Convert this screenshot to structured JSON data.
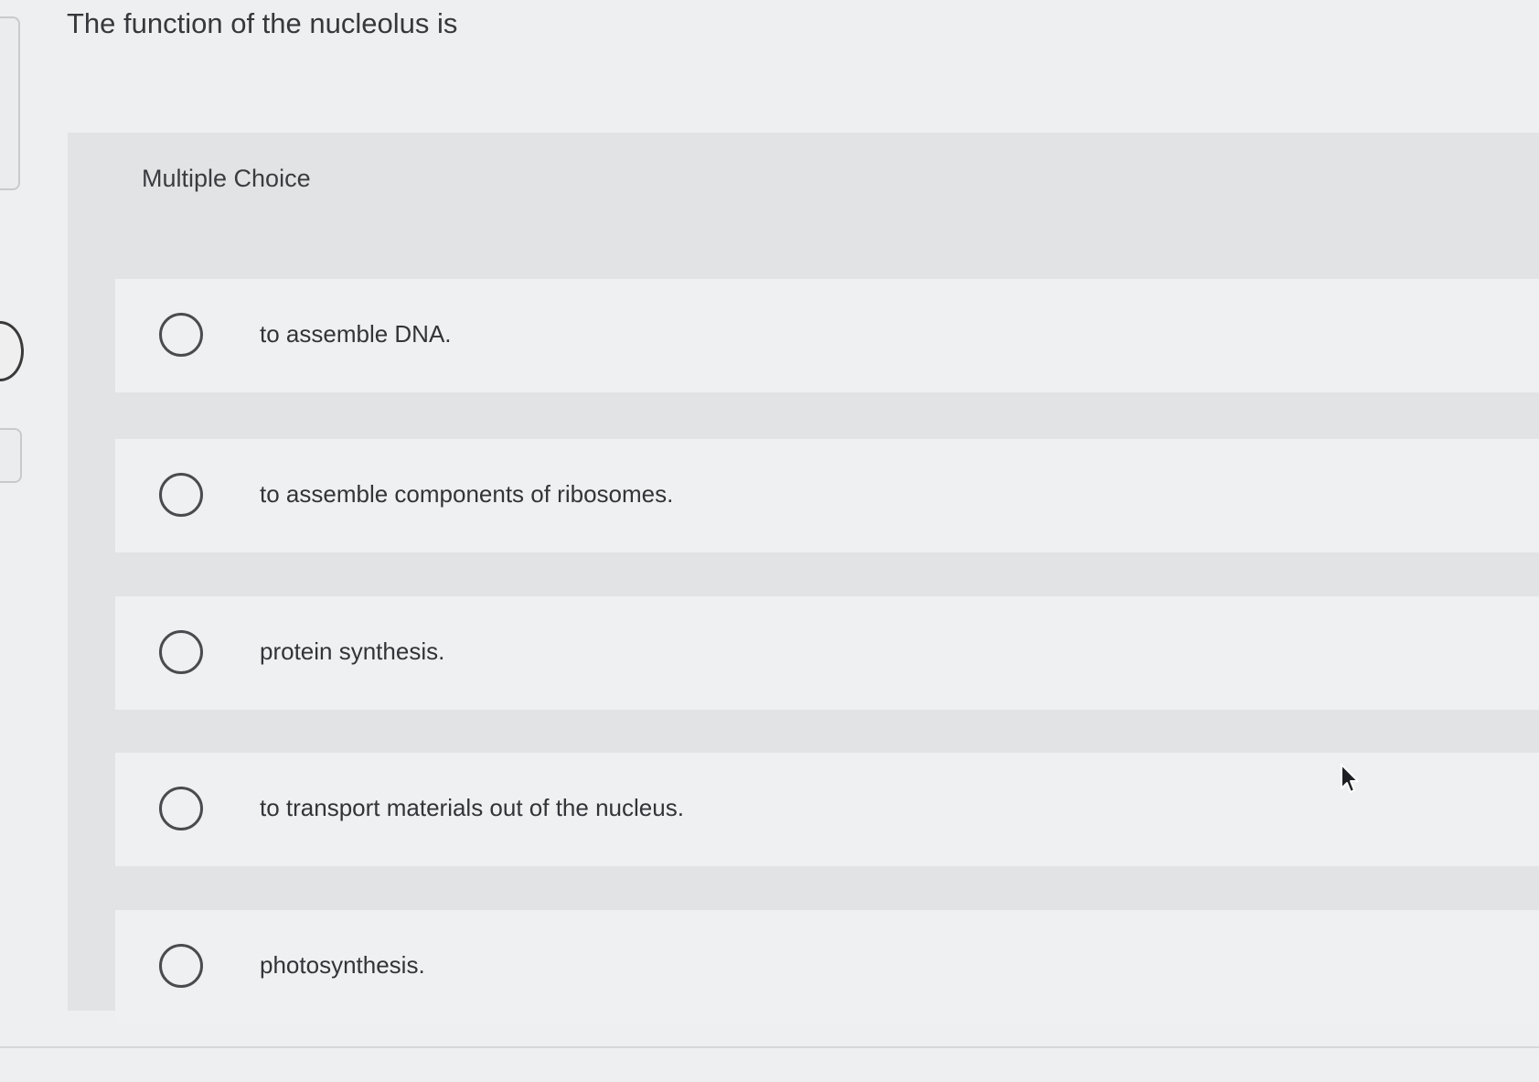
{
  "question": {
    "text": "The function of the nucleolus is"
  },
  "panel": {
    "title": "Multiple Choice",
    "options": [
      {
        "label": "to assemble DNA."
      },
      {
        "label": "to assemble components of ribosomes."
      },
      {
        "label": "protein synthesis."
      },
      {
        "label": "to transport materials out of the nucleus."
      },
      {
        "label": "photosynthesis."
      }
    ]
  },
  "icons": {
    "radio": "radio-unselected-icon",
    "cursor": "mouse-pointer-icon",
    "side_nav": "chevron-right-icon"
  },
  "colors": {
    "background": "#eeeff0",
    "panel": "#e2e3e5",
    "option": "#eef0f1",
    "text": "#333438"
  }
}
